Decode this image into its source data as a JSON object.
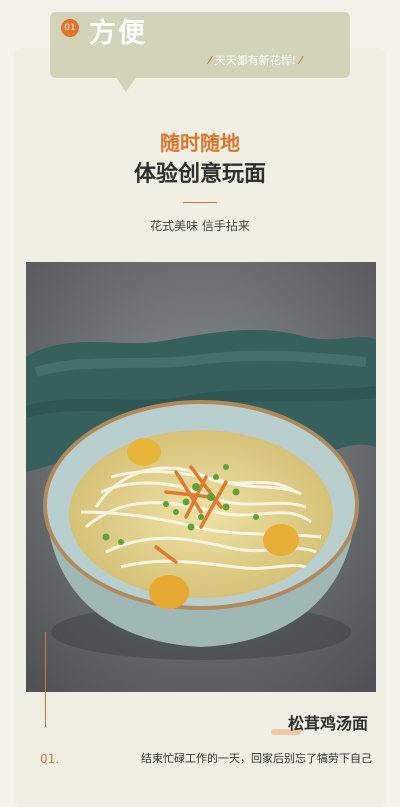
{
  "header": {
    "number": "01",
    "title": "方便",
    "slogan": "天天都有新花样!"
  },
  "subtitle": "随时随地",
  "title": "体验创意玩面",
  "tagline": "花式美味 信手拈来",
  "item": {
    "number": "01.",
    "name": "松茸鸡汤面",
    "description": "结束忙碌工作的一天，回家后别忘了犒劳下自己"
  },
  "colors": {
    "accent": "#e0742b",
    "header_bg": "#d2d3b9",
    "page_bg": "#f1efe4"
  }
}
